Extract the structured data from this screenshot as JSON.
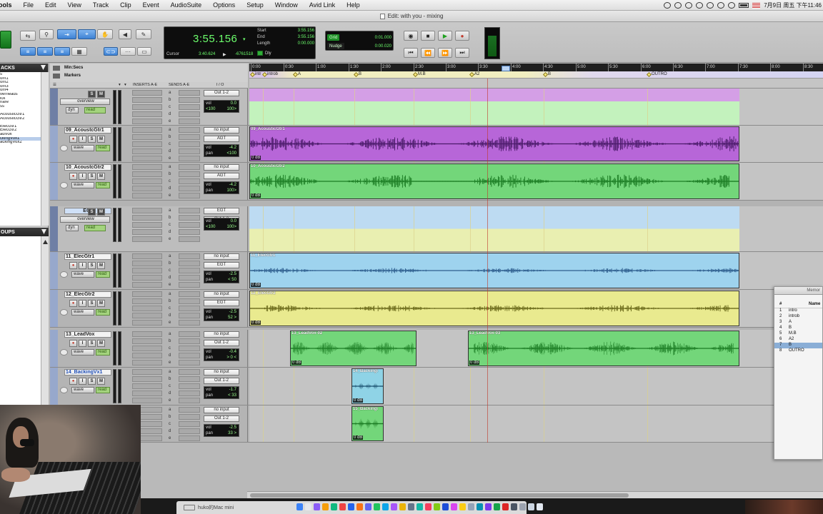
{
  "menubar": {
    "items": [
      "ools",
      "File",
      "Edit",
      "View",
      "Track",
      "Clip",
      "Event",
      "AudioSuite",
      "Options",
      "Setup",
      "Window",
      "Avid Link",
      "Help"
    ],
    "clock": "7月9日 周五 下午11:46"
  },
  "window": {
    "title": "Edit: with you - mixing"
  },
  "counter": {
    "main": "3:55.156",
    "start_label": "Start",
    "start_value": "3:55.156",
    "end_label": "End",
    "end_value": "3:55.156",
    "length_label": "Length",
    "length_value": "0:00.000",
    "cursor_label": "Cursor",
    "cursor_value": "3:40.624",
    "cursor_sample": "-6761518",
    "dly_label": "Dly"
  },
  "grid": {
    "grid_label": "Grid",
    "grid_value": "0:01.000",
    "nudge_label": "Nudge",
    "nudge_value": "0:00.020"
  },
  "left_panel": {
    "tracks_header": "ACKS",
    "tracks": [
      "s",
      "om1",
      "om2",
      "om3",
      "om4",
      "verheads",
      "ick",
      "nare",
      "ss",
      "",
      "AcousticGtr1",
      "AcousticGtr2",
      "",
      "ElecGtr1",
      "ElecGtr2",
      "adVox",
      "ckingVox1",
      "ackingVox2"
    ],
    "selected_index": 16,
    "groups_header": "OUPS"
  },
  "rulers": {
    "minsecs": "Min:Secs",
    "markers": "Markers"
  },
  "columns": {
    "inserts": "INSERTS A-E",
    "sends": "SENDS A-E",
    "io": "I / O"
  },
  "ruler_ticks": [
    "0:00",
    "0:30",
    "1:00",
    "1:30",
    "2:00",
    "2:30",
    "3:00",
    "3:30",
    "4:00",
    "4:30",
    "5:00",
    "5:30",
    "6:00",
    "6:30",
    "7:00",
    "7:30",
    "8:00",
    "8:30"
  ],
  "markers": [
    "intr",
    "introb",
    "A",
    "B",
    "M.B",
    "A2",
    "B",
    "OUTRO"
  ],
  "tracks": [
    {
      "id": "t0",
      "name": "",
      "output": "Out 1-2",
      "view": "overview",
      "auto": "read",
      "dyn": "dyn",
      "vol": "0.0",
      "pan_l": "<100",
      "pan_r": "100>"
    },
    {
      "id": "t1",
      "name": "09_AcoustcGtr1",
      "input": "no input",
      "output": "AGT",
      "vol": "-4.2",
      "pan": "<100",
      "clip": "09_AcousticGtr1",
      "wave_label": "wave",
      "auto": "read",
      "db": "0 dB"
    },
    {
      "id": "t2",
      "name": "10_AcoustcGtr2",
      "input": "no input",
      "output": "AGT",
      "vol": "-4.2",
      "pan": "100>",
      "clip": "10_AcousticGtr2",
      "wave_label": "wave",
      "auto": "read",
      "db": "0 dB"
    },
    {
      "id": "t3",
      "name": "EGT",
      "input": "EGT",
      "output": "Out 1-2",
      "view": "overview",
      "auto": "read",
      "dyn": "dyn",
      "vol": "0.0",
      "pan_l": "<100",
      "pan_r": "100>"
    },
    {
      "id": "t4",
      "name": "11_ElecGtr1",
      "input": "no input",
      "output": "EGT",
      "vol": "-2.5",
      "pan": "< 50",
      "clip": "11_ElecGtr1",
      "wave_label": "wave",
      "auto": "read",
      "db": "0 dB"
    },
    {
      "id": "t5",
      "name": "12_ElecGtr2",
      "input": "no input",
      "output": "EGT",
      "vol": "-2.5",
      "pan": "52 >",
      "clip": "12_ElecGtr2",
      "wave_label": "wave",
      "auto": "read",
      "db": "0 dB"
    },
    {
      "id": "t6",
      "name": "13_LeadVox",
      "input": "no input",
      "output": "Out 1-2",
      "vol": "-0.4",
      "pan": "> 0 <",
      "clip_a": "13_LeadVox-02",
      "clip_b": "13_LeadVox-03",
      "wave_label": "wave",
      "auto": "read",
      "db": "0 dB"
    },
    {
      "id": "t7",
      "name": "14_BackingVx1",
      "input": "no input",
      "output": "Out 1-2",
      "vol": "-1.7",
      "pan": "< 33",
      "clip": "14_Backing\\",
      "wave_label": "wave",
      "auto": "read",
      "db": "0 dB"
    },
    {
      "id": "t8",
      "name": "",
      "input": "no input",
      "output": "Out 1-2",
      "vol": "-2.5",
      "pan": "33 >",
      "clip": "15_Backing\\",
      "db": "0 dB"
    }
  ],
  "send_letters": [
    "a",
    "b",
    "c",
    "d",
    "e"
  ],
  "labels": {
    "vol": "vol",
    "pan": "pan",
    "s": "S",
    "m": "M",
    "i": "I"
  },
  "memory_window": {
    "title": "Memor",
    "col_num": "#",
    "col_name": "Name",
    "rows": [
      {
        "n": "1",
        "t": "intro"
      },
      {
        "n": "2",
        "t": "introb"
      },
      {
        "n": "3",
        "t": "A"
      },
      {
        "n": "4",
        "t": "B"
      },
      {
        "n": "5",
        "t": "M.B"
      },
      {
        "n": "6",
        "t": "A2"
      },
      {
        "n": "7",
        "t": "B"
      },
      {
        "n": "8",
        "t": "OUTRO"
      }
    ],
    "selected_index": 6
  },
  "dock": {
    "label": "huko的Mac mini"
  },
  "colors": {
    "purple_clip": "#b766d8",
    "green_clip": "#73d67a",
    "blue_clip": "#9ed3ee",
    "yellow_clip": "#e9ea8f",
    "counter_green": "#6dff6d"
  }
}
